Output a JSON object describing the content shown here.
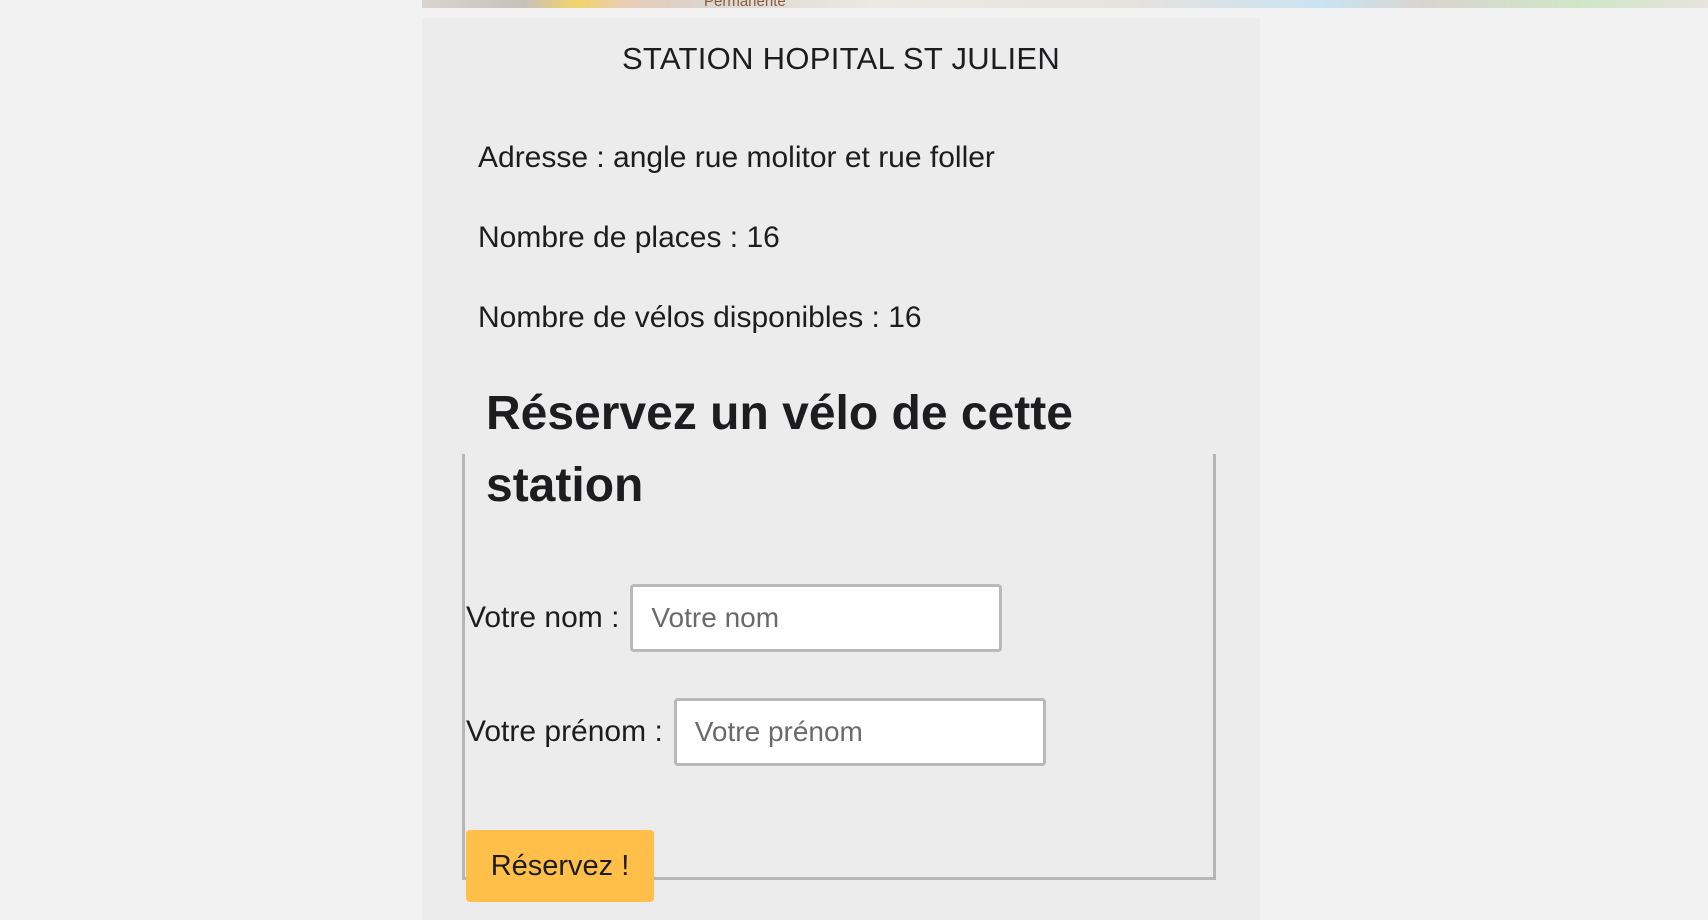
{
  "map": {
    "partial_label": "Permanente"
  },
  "station": {
    "title": "STATION HOPITAL ST JULIEN",
    "address": "Adresse : angle rue molitor et rue foller",
    "places": "Nombre de places : 16",
    "bikes_available": "Nombre de vélos disponibles : 16"
  },
  "reservation": {
    "heading": "Réservez un vélo de cette station",
    "nom_label": "Votre nom :",
    "nom_placeholder": "Votre nom",
    "nom_value": "",
    "prenom_label": "Votre prénom :",
    "prenom_placeholder": "Votre prénom",
    "prenom_value": "",
    "submit_label": "Réservez !",
    "submit_color": "#ffbf48"
  }
}
